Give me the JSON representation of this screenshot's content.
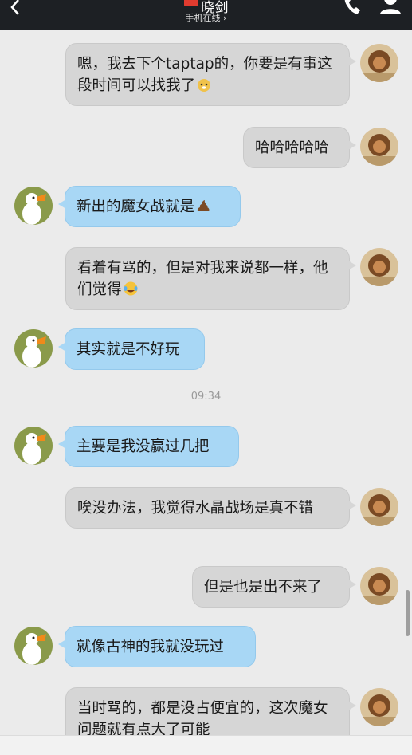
{
  "header": {
    "contact_name": "晓剑",
    "status": "手机在线 ›",
    "icons": [
      "back-icon",
      "phone-icon",
      "profile-icon"
    ]
  },
  "messages": [
    {
      "side": "me",
      "text": "嗯，我去下个taptap的，你要是有事这段时间可以找我了",
      "emoji": "dog-face-emoji"
    },
    {
      "side": "me",
      "text": "哈哈哈哈哈"
    },
    {
      "side": "peer",
      "text": "新出的魔女战就是",
      "emoji": "pile-of-poo-emoji"
    },
    {
      "side": "me",
      "text": "看着有骂的，但是对我来说都一样，他们觉得",
      "emoji": "tears-of-joy-emoji"
    },
    {
      "side": "peer",
      "text": "其实就是不好玩"
    },
    {
      "side": "peer",
      "text": "主要是我没赢过几把"
    },
    {
      "side": "me",
      "text": "唉没办法，我觉得水晶战场是真不错"
    },
    {
      "side": "me",
      "text": "但是也是出不来了"
    },
    {
      "side": "peer",
      "text": "就像古神的我就没玩过"
    },
    {
      "side": "me",
      "text": "当时骂的，都是没占便宜的，这次魔女问题就有点大了可能"
    }
  ],
  "timestamp": "09:34",
  "colors": {
    "header_bg": "#1d2024",
    "chat_bg": "#ebebeb",
    "outgoing_bubble": "#d6d6d6",
    "incoming_bubble": "#a8d7f5"
  }
}
